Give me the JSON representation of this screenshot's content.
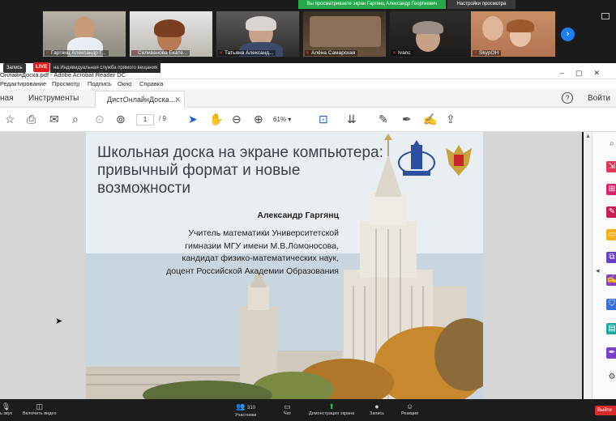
{
  "zoom": {
    "share_banner": "Вы просматриваете экран Гаргянц Александр Георгиевич",
    "view_options": "Настройки просмотра",
    "participants": [
      {
        "name": "Гаргянц Александр Г..."
      },
      {
        "name": "Селиванова Екате..."
      },
      {
        "name": "Татьяна Александ..."
      },
      {
        "name": "Алёна Самарская"
      },
      {
        "name": "Ivanc"
      },
      {
        "name": "SkypOH"
      }
    ],
    "rec_label": "Запись",
    "live_label": "LIVE",
    "stream_label": "на Индивидуальная служба прямого вещания",
    "bottom": {
      "audio": "ь звук",
      "video": "Включить видео",
      "participants": "Участники",
      "participants_count": "310",
      "chat": "Чат",
      "share": "Демонстрация экрана",
      "record": "Запись",
      "reactions": "Реакции",
      "exit": "Выйти"
    }
  },
  "acrobat": {
    "window_title": "ОнлайнДоска.pdf - Adobe Acrobat Reader DC",
    "menu": [
      "Редактирование",
      "Просмотр",
      "Подпись",
      "Окно",
      "Справка"
    ],
    "tab_home": "ная",
    "tab_tools": "Инструменты",
    "tab_doc": "ДистОнлайнДоска....",
    "signin": "Войти",
    "page_current": "1",
    "page_total": "/ 9",
    "zoom_level": "61%"
  },
  "slide": {
    "title": "Школьная доска на экране компьютера: привычный формат и новые возможности",
    "author": "Александр Гаргянц",
    "affiliation_lines": [
      "Учитель математики Университетской",
      "гимназии МГУ имени М.В.Ломоносова,",
      "кандидат физико-математических наук,",
      "доцент Российской Академии Образования"
    ]
  }
}
